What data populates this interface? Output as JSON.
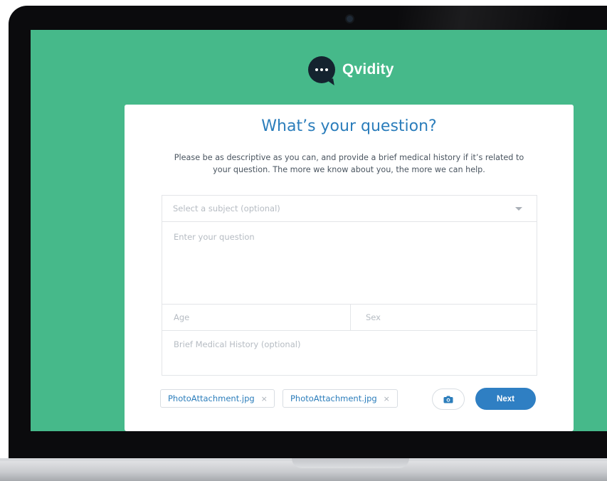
{
  "brand": {
    "name": "Qvidity",
    "background_color": "#46b98a",
    "logo_icon": "chat-bubble-dots-icon"
  },
  "card": {
    "title": "What’s your question?",
    "description": "Please be as descriptive as you can, and provide a brief medical history if it’s related to your question. The more we know about you, the more we can help."
  },
  "form": {
    "subject_placeholder": "Select a subject (optional)",
    "question_placeholder": "Enter your question",
    "age_placeholder": "Age",
    "sex_placeholder": "Sex",
    "history_placeholder": "Brief Medical History (optional)"
  },
  "attachments": [
    {
      "filename": "PhotoAttachment.jpg",
      "remove_glyph": "×"
    },
    {
      "filename": "PhotoAttachment.jpg",
      "remove_glyph": "×"
    }
  ],
  "actions": {
    "camera_icon": "camera-icon",
    "next_label": "Next",
    "accent_color": "#2f7fc3"
  }
}
